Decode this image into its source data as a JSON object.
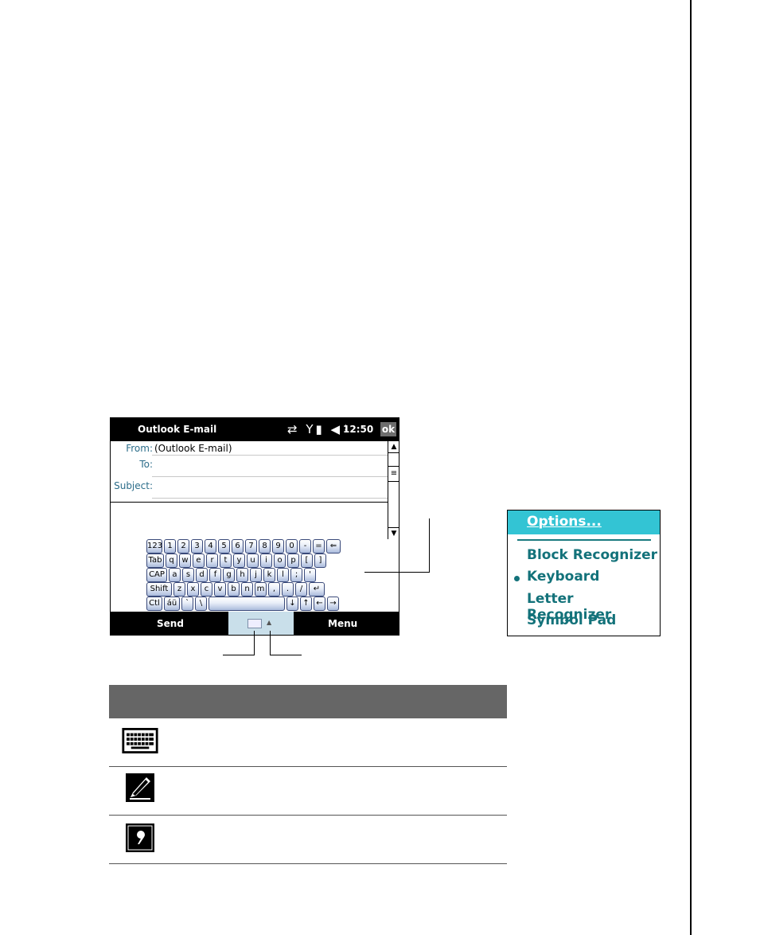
{
  "phone": {
    "title": "Outlook E-mail",
    "status_icons": "⇄ Y▮ ◀ᛍ",
    "time": "12:50",
    "ok": "ok",
    "from_label": "From:",
    "from_value": "(Outlook E-mail)",
    "to_label": "To:",
    "subject_label": "Subject:",
    "keyboard_rows": [
      [
        "123",
        "1",
        "2",
        "3",
        "4",
        "5",
        "6",
        "7",
        "8",
        "9",
        "0",
        "-",
        "=",
        "⇐"
      ],
      [
        "Tab",
        "q",
        "w",
        "e",
        "r",
        "t",
        "y",
        "u",
        "i",
        "o",
        "p",
        "[",
        "]"
      ],
      [
        "CAP",
        "a",
        "s",
        "d",
        "f",
        "g",
        "h",
        "j",
        "k",
        "l",
        ";",
        "'"
      ],
      [
        "Shift",
        "z",
        "x",
        "c",
        "v",
        "b",
        "n",
        "m",
        ",",
        ".",
        "/",
        "↵"
      ],
      [
        "Ctl",
        "áü",
        "`",
        "\\",
        " ",
        "↓",
        "↑",
        "←",
        "→"
      ]
    ],
    "send_label": "Send",
    "menu_label": "Menu"
  },
  "options_menu": {
    "header": "Options...",
    "items": [
      "Block Recognizer",
      "Keyboard",
      "Letter Recognizer",
      "Symbol Pad"
    ],
    "selected": "Keyboard"
  },
  "table": {
    "rows": [
      {
        "icon": "keyboard-icon"
      },
      {
        "icon": "pen-icon"
      },
      {
        "icon": "symbol-pad-icon"
      }
    ]
  }
}
